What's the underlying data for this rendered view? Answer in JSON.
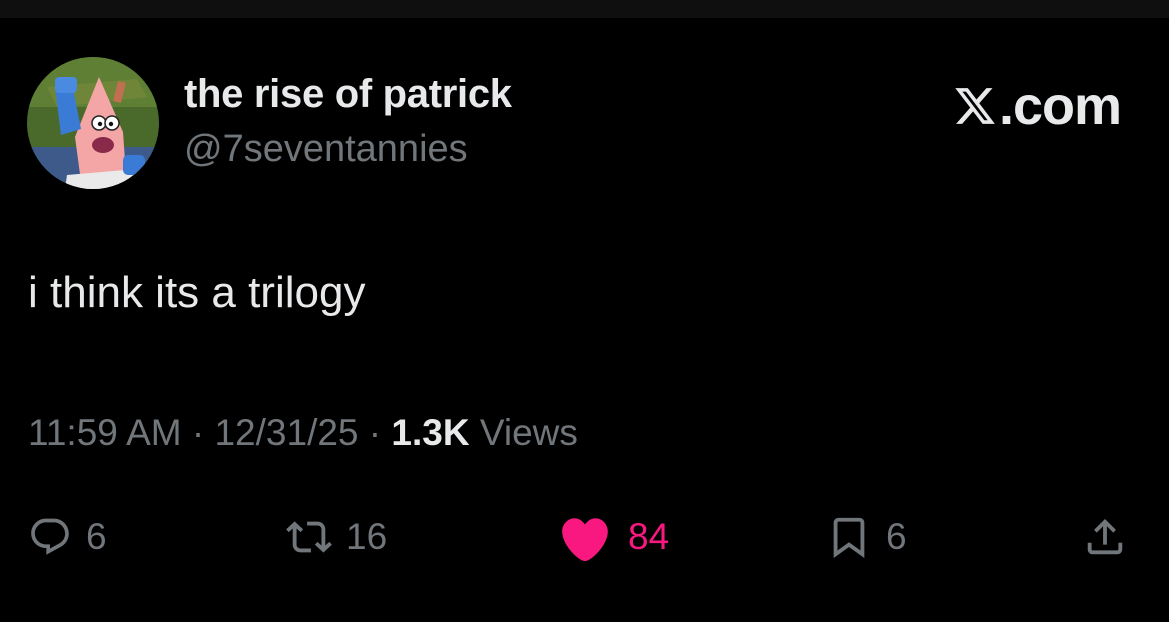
{
  "author": {
    "display_name": "the rise of patrick",
    "handle": "@7seventannies",
    "avatar_icon": "avatar-patrick-star"
  },
  "watermark": {
    "logo_icon": "x-logo-icon",
    "text": ".com"
  },
  "tweet": {
    "text": "i think its a trilogy",
    "time": "11:59 AM",
    "separator": " · ",
    "date": "12/31/25",
    "views_count": "1.3K",
    "views_label": " Views"
  },
  "actions": {
    "reply": {
      "icon": "reply-icon",
      "count": "6"
    },
    "retweet": {
      "icon": "retweet-icon",
      "count": "16"
    },
    "like": {
      "icon": "heart-icon",
      "count": "84",
      "liked": true
    },
    "bookmark": {
      "icon": "bookmark-icon",
      "count": "6"
    },
    "share": {
      "icon": "share-icon"
    }
  },
  "colors": {
    "background": "#000000",
    "text_primary": "#e7e9ea",
    "text_secondary": "#71767b",
    "like_pink": "#f91880"
  }
}
